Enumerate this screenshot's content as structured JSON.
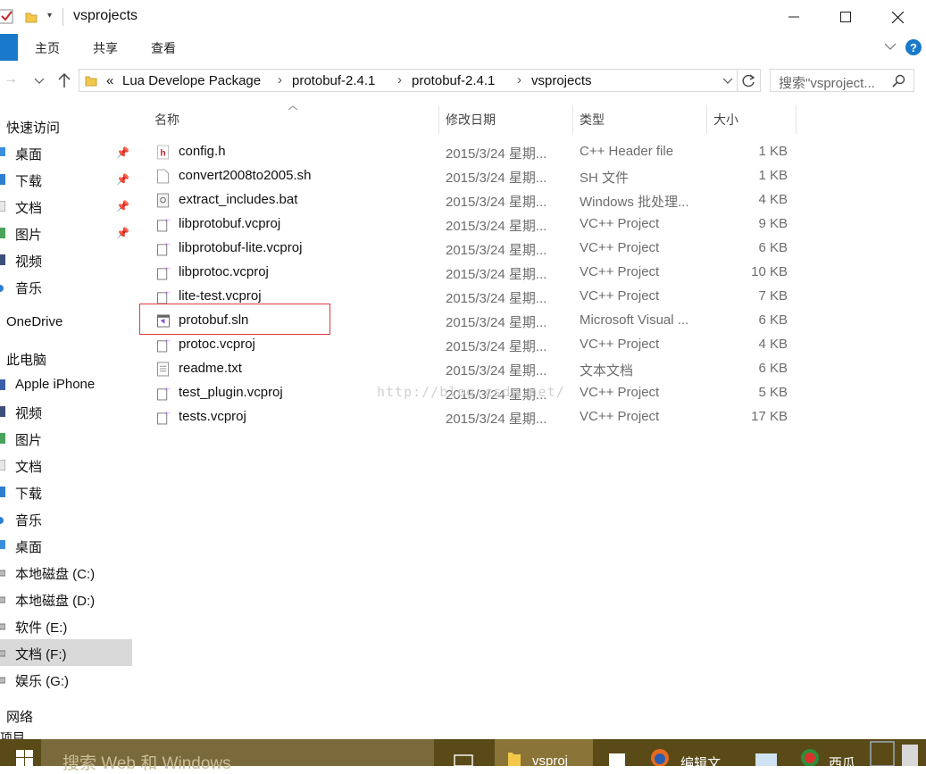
{
  "window": {
    "title": "vsprojects",
    "controls": [
      "minimize",
      "maximize",
      "close"
    ]
  },
  "ribbon": {
    "tabs": [
      "主页",
      "共享",
      "查看"
    ]
  },
  "address": {
    "overflow": "«",
    "breadcrumbs": [
      "Lua Develope Package",
      "protobuf-2.4.1",
      "protobuf-2.4.1",
      "vsprojects"
    ],
    "search_placeholder": "搜索\"vsproject..."
  },
  "sidebar": {
    "items": [
      {
        "label": "快速访问",
        "icon": "star-icon"
      },
      {
        "label": "桌面",
        "icon": "desktop-folder-icon",
        "pinned": true
      },
      {
        "label": "下载",
        "icon": "download-folder-icon",
        "pinned": true
      },
      {
        "label": "文档",
        "icon": "documents-folder-icon",
        "pinned": true
      },
      {
        "label": "图片",
        "icon": "pictures-folder-icon",
        "pinned": true
      },
      {
        "label": "视频",
        "icon": "videos-folder-icon"
      },
      {
        "label": "音乐",
        "icon": "music-folder-icon"
      },
      {
        "label": "OneDrive",
        "icon": "cloud-icon"
      },
      {
        "label": "此电脑",
        "icon": "computer-icon"
      },
      {
        "label": "Apple iPhone",
        "icon": "phone-icon"
      },
      {
        "label": "视频",
        "icon": "videos-folder-icon"
      },
      {
        "label": "图片",
        "icon": "pictures-folder-icon"
      },
      {
        "label": "文档",
        "icon": "documents-folder-icon"
      },
      {
        "label": "下载",
        "icon": "download-folder-icon"
      },
      {
        "label": "音乐",
        "icon": "music-folder-icon"
      },
      {
        "label": "桌面",
        "icon": "desktop-folder-icon"
      },
      {
        "label": "本地磁盘 (C:)",
        "icon": "drive-icon"
      },
      {
        "label": "本地磁盘 (D:)",
        "icon": "drive-icon"
      },
      {
        "label": "软件 (E:)",
        "icon": "drive-icon"
      },
      {
        "label": "文档 (F:)",
        "icon": "drive-icon",
        "selected": true
      },
      {
        "label": "娱乐 (G:)",
        "icon": "drive-icon"
      },
      {
        "label": "网络",
        "icon": "network-icon"
      },
      {
        "label": "项目",
        "icon": "folder-icon"
      }
    ]
  },
  "columns": {
    "name": "名称",
    "date": "修改日期",
    "type": "类型",
    "size": "大小"
  },
  "files": [
    {
      "name": "config.h",
      "date": "2015/3/24 星期...",
      "type": "C++ Header file",
      "size": "1 KB",
      "icon": "h-file-icon"
    },
    {
      "name": "convert2008to2005.sh",
      "date": "2015/3/24 星期...",
      "type": "SH 文件",
      "size": "1 KB",
      "icon": "blank-file-icon"
    },
    {
      "name": "extract_includes.bat",
      "date": "2015/3/24 星期...",
      "type": "Windows 批处理...",
      "size": "4 KB",
      "icon": "bat-file-icon"
    },
    {
      "name": "libprotobuf.vcproj",
      "date": "2015/3/24 星期...",
      "type": "VC++ Project",
      "size": "9 KB",
      "icon": "vcproj-file-icon"
    },
    {
      "name": "libprotobuf-lite.vcproj",
      "date": "2015/3/24 星期...",
      "type": "VC++ Project",
      "size": "6 KB",
      "icon": "vcproj-file-icon"
    },
    {
      "name": "libprotoc.vcproj",
      "date": "2015/3/24 星期...",
      "type": "VC++ Project",
      "size": "10 KB",
      "icon": "vcproj-file-icon"
    },
    {
      "name": "lite-test.vcproj",
      "date": "2015/3/24 星期...",
      "type": "VC++ Project",
      "size": "7 KB",
      "icon": "vcproj-file-icon"
    },
    {
      "name": "protobuf.sln",
      "date": "2015/3/24 星期...",
      "type": "Microsoft Visual ...",
      "size": "6 KB",
      "icon": "sln-file-icon",
      "highlighted": true
    },
    {
      "name": "protoc.vcproj",
      "date": "2015/3/24 星期...",
      "type": "VC++ Project",
      "size": "4 KB",
      "icon": "vcproj-file-icon"
    },
    {
      "name": "readme.txt",
      "date": "2015/3/24 星期...",
      "type": "文本文档",
      "size": "6 KB",
      "icon": "txt-file-icon"
    },
    {
      "name": "test_plugin.vcproj",
      "date": "2015/3/24 星期...",
      "type": "VC++ Project",
      "size": "5 KB",
      "icon": "vcproj-file-icon"
    },
    {
      "name": "tests.vcproj",
      "date": "2015/3/24 星期...",
      "type": "VC++ Project",
      "size": "17 KB",
      "icon": "vcproj-file-icon"
    }
  ],
  "watermark": "http://blog.csdn.net/",
  "taskbar": {
    "search_text": "搜索 Web 和 Windows",
    "apps": [
      {
        "label": "vsproj",
        "icon": "folder-icon"
      },
      {
        "label": "编辑文",
        "icon": "firefox-icon"
      },
      {
        "label": "西瓜",
        "icon": "xigua-icon"
      }
    ]
  },
  "colors": {
    "accent": "#1979ca",
    "highlight_box": "#e0393e",
    "taskbar": "#5a4a17",
    "selected_nav": "#d9d9d9"
  }
}
